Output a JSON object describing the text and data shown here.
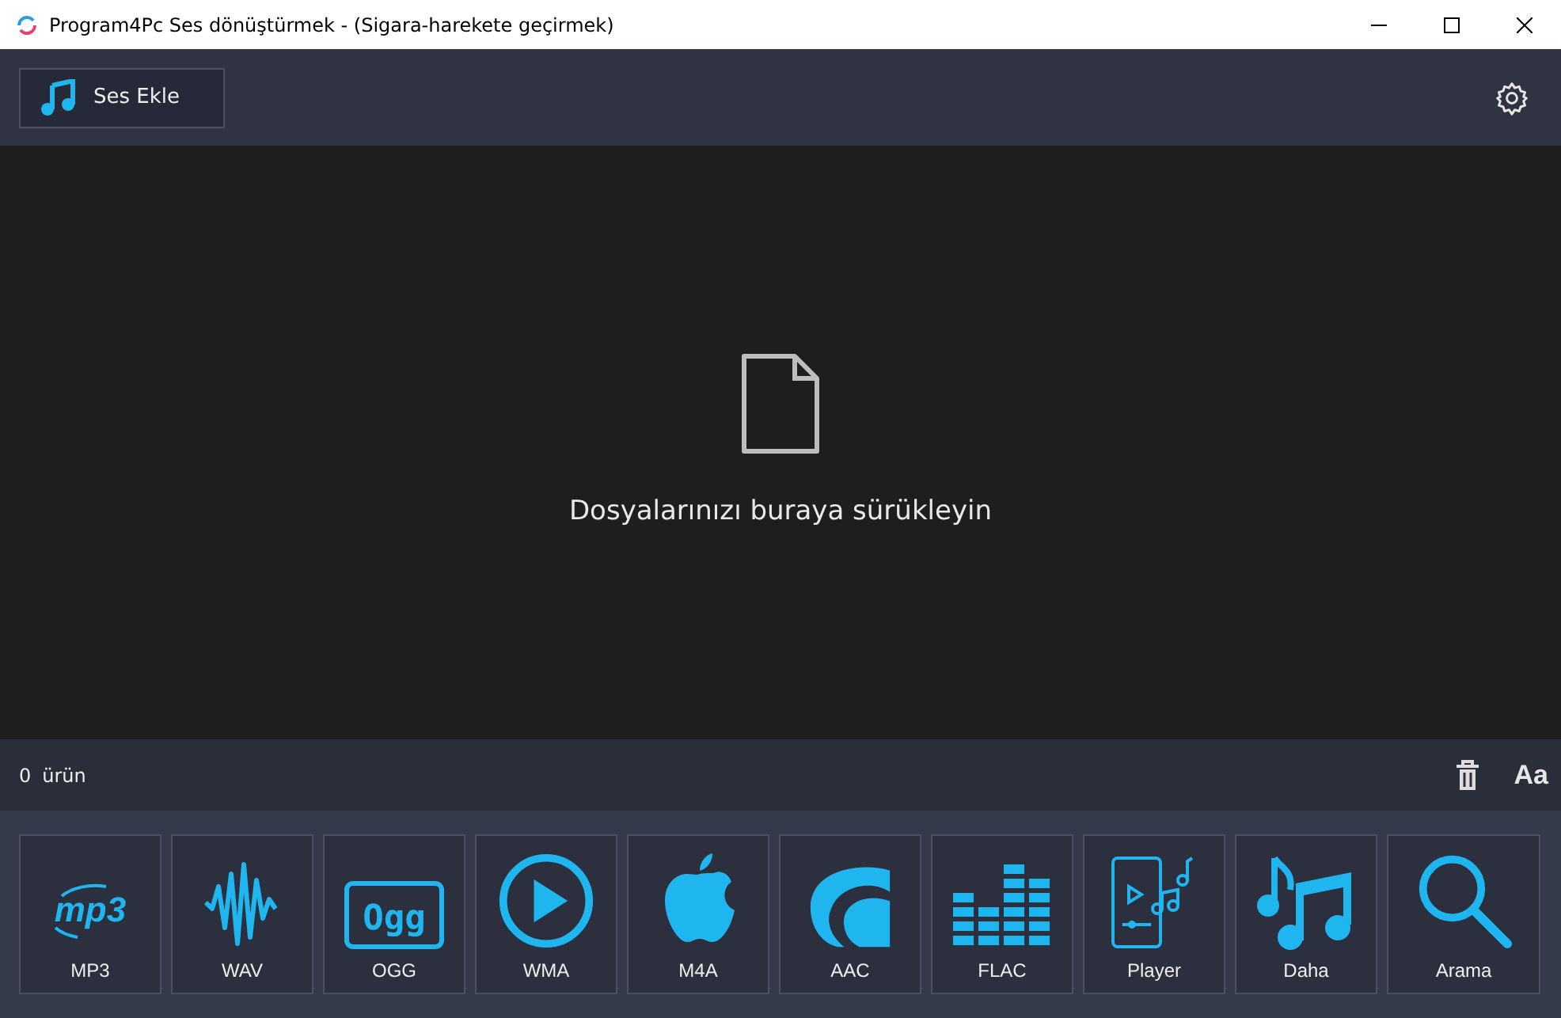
{
  "window": {
    "title": "Program4Pc Ses dönüştürmek - (Sigara-harekete geçirmek)"
  },
  "toolbar": {
    "add_button": "Ses Ekle"
  },
  "drop_area": {
    "message": "Dosyalarınızı buraya sürükleyin"
  },
  "status_bar": {
    "count": "0",
    "count_label": "ürün",
    "font_button": "Aa"
  },
  "formats": [
    {
      "kind": "mp3",
      "label": "MP3",
      "logo": "mp3"
    },
    {
      "kind": "wav",
      "label": "WAV"
    },
    {
      "kind": "ogg",
      "label": "OGG",
      "logo": "Ogg"
    },
    {
      "kind": "wma",
      "label": "WMA"
    },
    {
      "kind": "m4a",
      "label": "M4A"
    },
    {
      "kind": "aac",
      "label": "AAC"
    },
    {
      "kind": "flac",
      "label": "FLAC"
    },
    {
      "kind": "player",
      "label": "Player"
    },
    {
      "kind": "more",
      "label": "Daha"
    },
    {
      "kind": "search",
      "label": "Arama"
    }
  ]
}
